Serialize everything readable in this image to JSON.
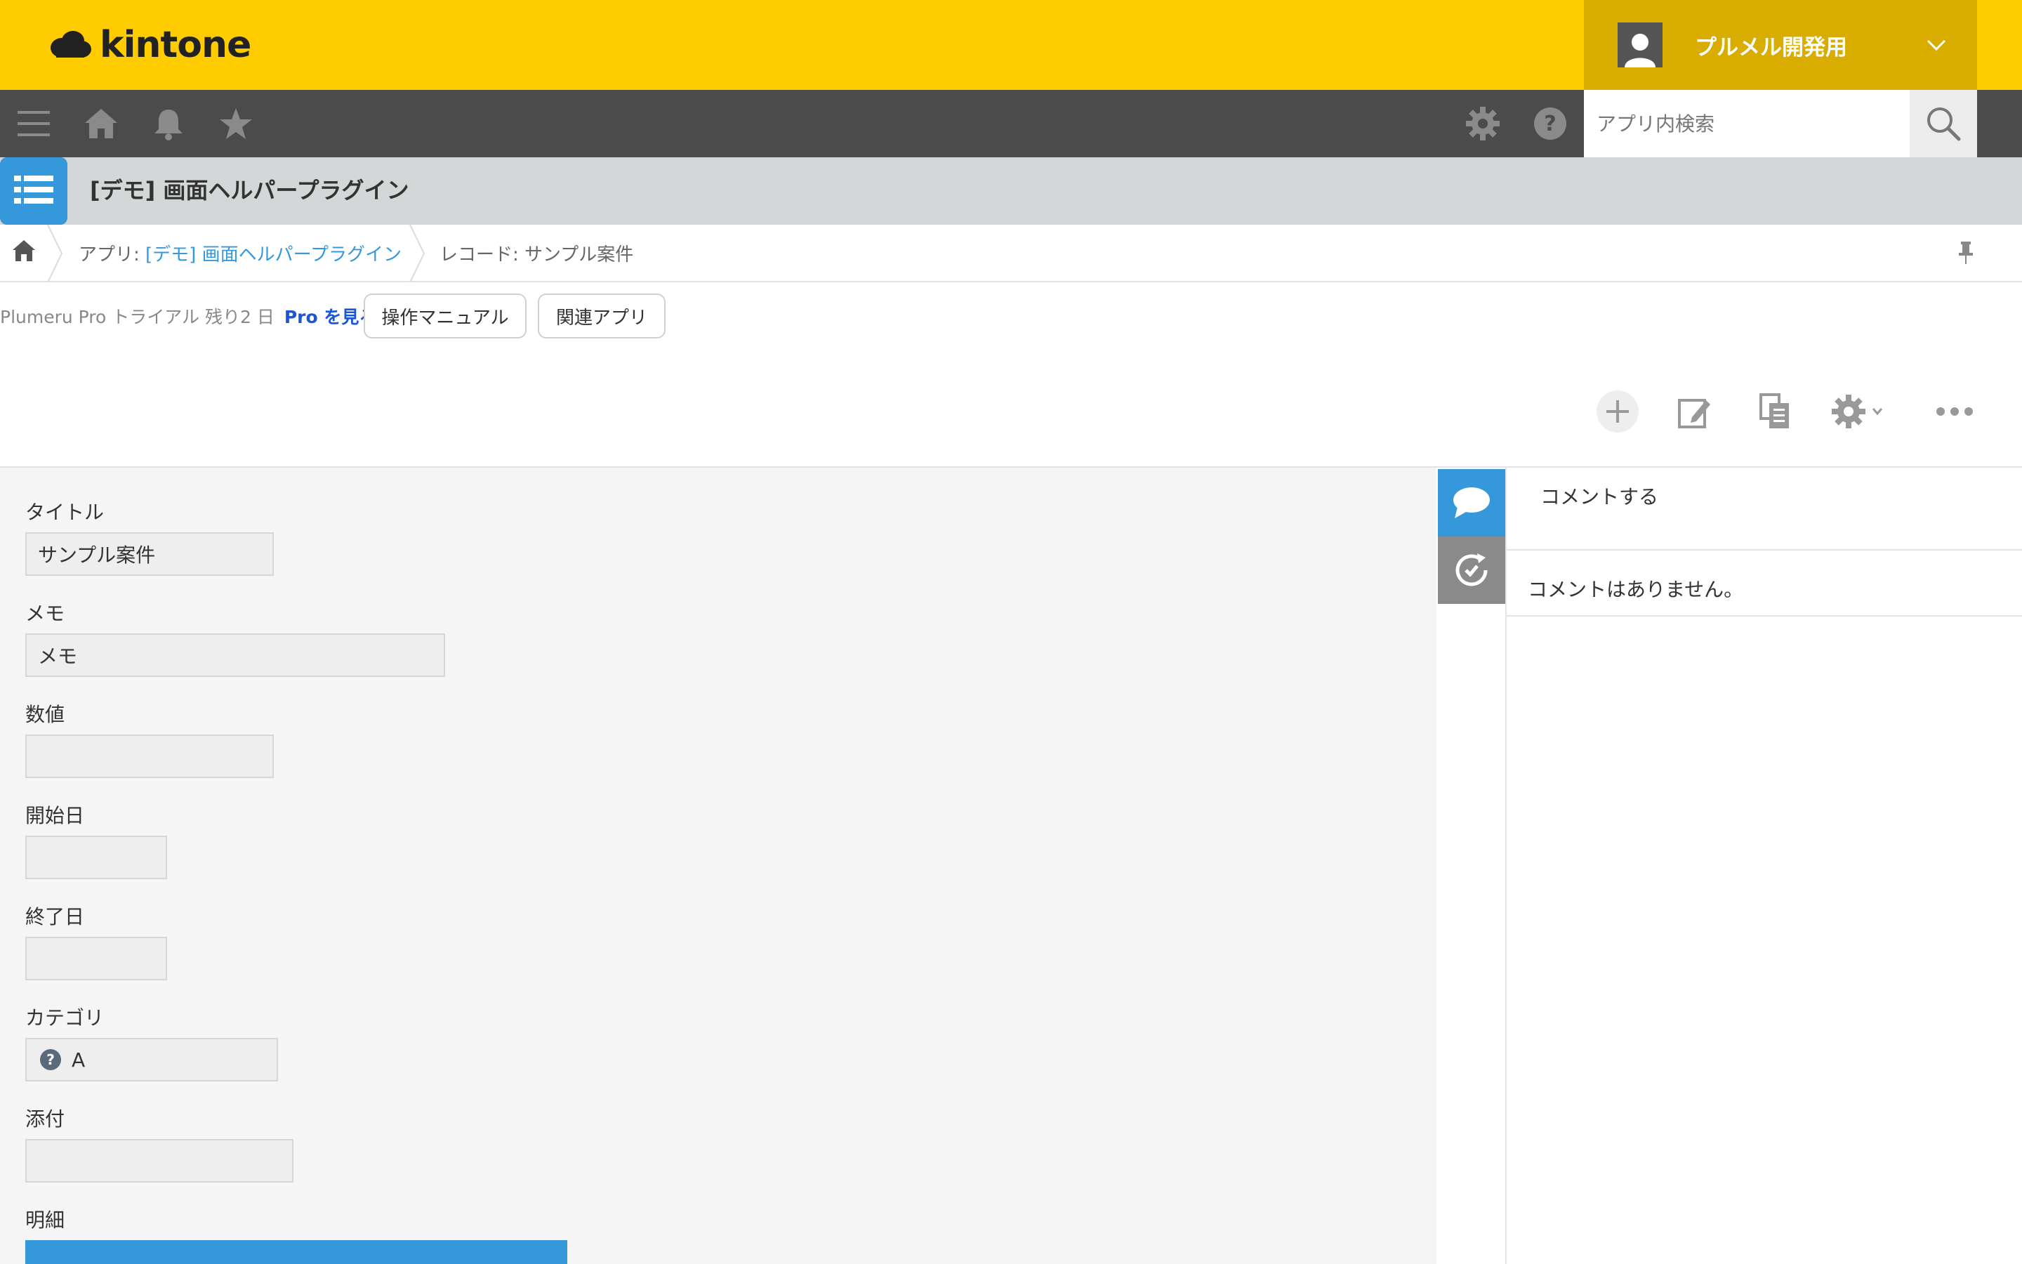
{
  "header": {
    "logo_text": "kintone",
    "user_name": "プルメル開発用",
    "brand_color": "#ffcc00"
  },
  "toolbar": {
    "icons": [
      "menu-icon",
      "home-icon",
      "bell-icon",
      "star-icon",
      "gear-icon",
      "help-icon"
    ],
    "search_placeholder": "アプリ内検索"
  },
  "app": {
    "title": "[デモ] 画面ヘルパープラグイン"
  },
  "breadcrumb": {
    "app_prefix": "アプリ: ",
    "app_link": "[デモ] 画面ヘルパープラグイン",
    "record": "レコード: サンプル案件"
  },
  "pro": {
    "trial_text": "Plumeru Pro トライアル 残り2 日",
    "link_text": "Pro を見る"
  },
  "buttons": {
    "manual": "操作マニュアル",
    "related_apps": "関連アプリ"
  },
  "form": {
    "fields": [
      {
        "label": "タイトル",
        "value": "サンプル案件"
      },
      {
        "label": "メモ",
        "value": "メモ"
      },
      {
        "label": "数値",
        "value": ""
      },
      {
        "label": "開始日",
        "value": ""
      },
      {
        "label": "終了日",
        "value": ""
      },
      {
        "label": "カテゴリ",
        "value": "A"
      },
      {
        "label": "添付",
        "value": ""
      },
      {
        "label": "明細",
        "value": ""
      }
    ]
  },
  "comments": {
    "placeholder": "コメントする",
    "empty": "コメントはありません。"
  }
}
